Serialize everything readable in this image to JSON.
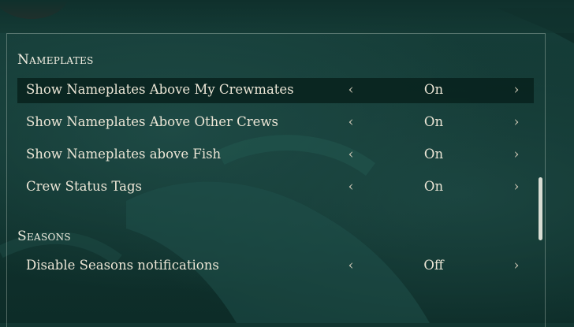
{
  "sections": [
    {
      "title": "Nameplates",
      "rows": [
        {
          "label": "Show Nameplates Above My Crewmates",
          "value": "On"
        },
        {
          "label": "Show Nameplates Above Other Crews",
          "value": "On"
        },
        {
          "label": "Show Nameplates above Fish",
          "value": "On"
        },
        {
          "label": "Crew Status Tags",
          "value": "On"
        }
      ]
    },
    {
      "title": "Seasons",
      "rows": [
        {
          "label": "Disable Seasons notifications",
          "value": "Off"
        }
      ]
    }
  ],
  "arrows": {
    "left": "‹",
    "right": "›"
  },
  "icons": {
    "left": "chevron-left-icon",
    "right": "chevron-right-icon"
  },
  "colors": {
    "background": "#123631",
    "selected_row": "#08221e",
    "text": "#ece6d6"
  }
}
